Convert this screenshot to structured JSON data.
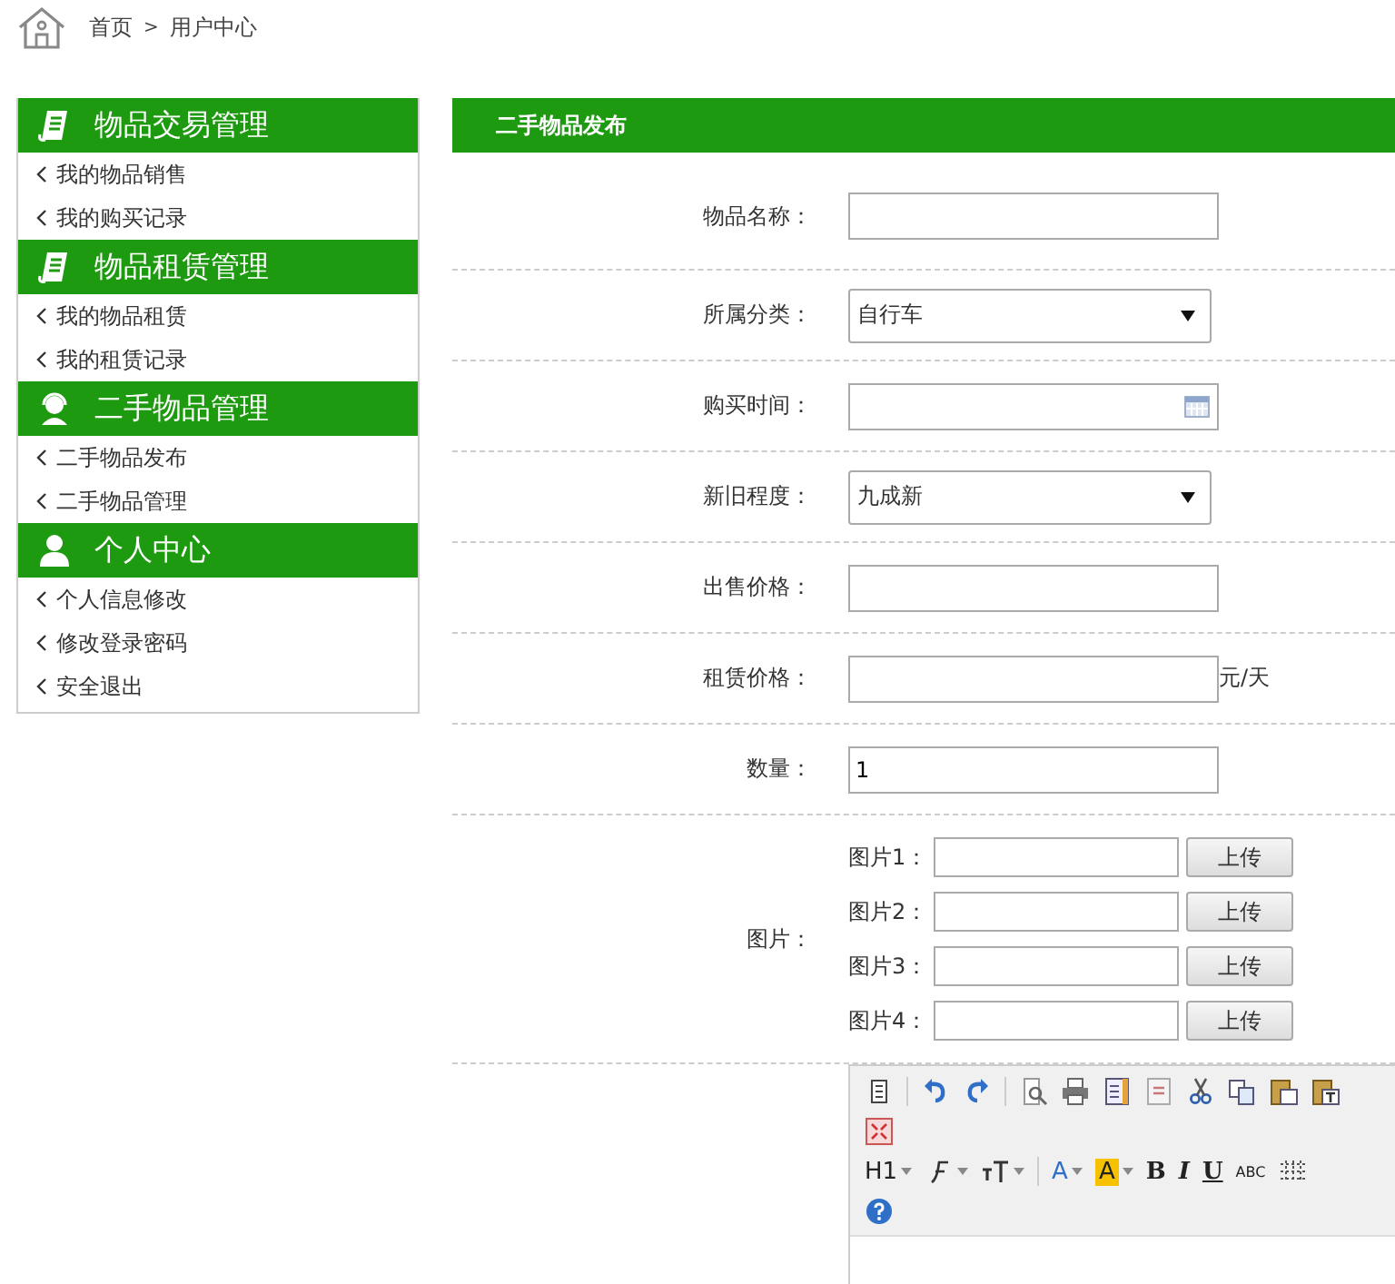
{
  "breadcrumb": {
    "home": "首页",
    "separator": ">",
    "current": "用户中心"
  },
  "sidebar": {
    "groups": [
      {
        "title": "物品交易管理",
        "kind": "notebook",
        "items": [
          "我的物品销售",
          "我的购买记录"
        ]
      },
      {
        "title": "物品租赁管理",
        "kind": "notebook",
        "items": [
          "我的物品租赁",
          "我的租赁记录"
        ]
      },
      {
        "title": "二手物品管理",
        "kind": "headset",
        "items": [
          "二手物品发布",
          "二手物品管理"
        ]
      },
      {
        "title": "个人中心",
        "kind": "person",
        "items": [
          "个人信息修改",
          "修改登录密码",
          "安全退出"
        ]
      }
    ]
  },
  "panel": {
    "title": "二手物品发布",
    "rows": [
      {
        "kind": "text",
        "label": "物品名称："
      },
      {
        "kind": "select",
        "label": "所属分类：",
        "value": "自行车"
      },
      {
        "kind": "date",
        "label": "购买时间："
      },
      {
        "kind": "select",
        "label": "新旧程度：",
        "value": "九成新"
      },
      {
        "kind": "text",
        "label": "出售价格："
      },
      {
        "kind": "text",
        "label": "租赁价格：",
        "suffix": "元/天"
      },
      {
        "kind": "text",
        "label": "数量：",
        "value": "1"
      },
      {
        "kind": "pictures",
        "label": "图片：",
        "pictures": [
          {
            "label": "图片1：",
            "button": "上传"
          },
          {
            "label": "图片2：",
            "button": "上传"
          },
          {
            "label": "图片3：",
            "button": "上传"
          },
          {
            "label": "图片4：",
            "button": "上传"
          }
        ]
      },
      {
        "kind": "editor",
        "toolbar": [
          [
            {
              "kind": "source"
            },
            {
              "kind": "sep"
            },
            {
              "kind": "undo"
            },
            {
              "kind": "redo"
            },
            {
              "kind": "sep"
            },
            {
              "kind": "preview"
            },
            {
              "kind": "print"
            },
            {
              "kind": "template"
            },
            {
              "kind": "code"
            },
            {
              "kind": "cut"
            },
            {
              "kind": "copy"
            },
            {
              "kind": "paste"
            },
            {
              "kind": "pastetext"
            }
          ],
          [
            {
              "kind": "fullscreen"
            }
          ],
          [
            {
              "kind": "heading",
              "label": "H1"
            },
            {
              "kind": "fontfamily"
            },
            {
              "kind": "fontsize"
            },
            {
              "kind": "sep"
            },
            {
              "kind": "forecolor",
              "label": "A"
            },
            {
              "kind": "backcolor",
              "label": "A"
            },
            {
              "kind": "bold",
              "label": "B"
            },
            {
              "kind": "italic",
              "label": "I"
            },
            {
              "kind": "underline",
              "label": "U"
            },
            {
              "kind": "strike",
              "label": "ABC"
            },
            {
              "kind": "table"
            }
          ],
          [
            {
              "kind": "help"
            }
          ]
        ]
      }
    ]
  }
}
